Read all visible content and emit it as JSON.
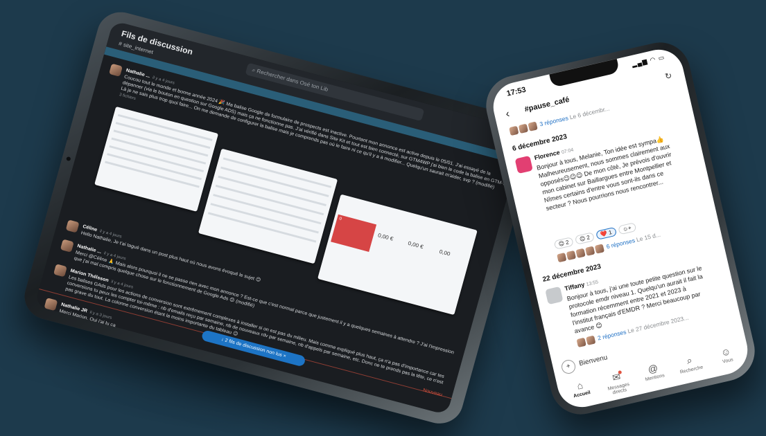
{
  "tablet": {
    "title": "Fils de discussion",
    "channel": "# site_internet",
    "search_placeholder": "Rechercher dans Osé ton Lib",
    "messages": [
      {
        "name": "Nathalie ...",
        "time": "il y a 4 jours",
        "text": "Coucou tout le monde et bonne année 2024 🎉 Ma balise Google de formulaire de prospects est inactive. Pourtant mon annonce est active depuis le 05/01. J'ai essayé de la dépanner (via le bouton en question sur Google ADS) mais ça ne fonctionne pas. J'ai vérifié dans Site Kit et tout est bien connecté, sur GTM4WP j'ai bien le code la balise en GTM-. Là je ne sais plus trop quoi faire... On me demande de configurer la balise mais je comprends pas où le faire ni ce qu'il y a à modifier... Quelqu'un saurait m'aider, svp ? (modifié)",
        "files": "3 fichiers"
      },
      {
        "name": "Céline",
        "time": "il y a 4 jours",
        "text": "Hello Nathalie, Je t'ai tagué dans un post plus haut où nous avons évoqué le sujet 😊"
      },
      {
        "name": "Nathalie ...",
        "time": "il y a 4 jours",
        "text": "Merci @Céline 🙏 Mais alors pourquoi il ne se passe rien avec mon annonce ? Est-ce que c'est normal parce que justement il y a quelques semaines à attendre ? J'ai l'impression que j'ai mal compris quelque chose sur le fonctionnement de Google Ads 😊 (modifié)"
      },
      {
        "name": "Marion Théîsson",
        "time": "il y a 4 jours",
        "text": "Les balises GAds pour les actions de conversion sont extrêmement complexes à installer si on est pas du milieu. Mais comme expliqué plus haut, ça n'a pas d'importance car tes conversions tu peux les compter toi-même : nb d'emails reçu par semaine, nb de nouveaux rdv par semaine, nb d'appels par semaine, etc. Donc ne te prends pas la tête, ce n'est pas grave du tout. La colonne conversion étant la moins importante du tableau 😉"
      },
      {
        "name": "Nathalie JR",
        "time": "il y a 3 jours",
        "text": "Merci Marion, Oui j'ai lu ça"
      }
    ],
    "shot_values": [
      "0",
      "0,00 €",
      "0,00 €",
      "0,00"
    ],
    "unread_pill": "↓ 2 fils de discussion non lus ×",
    "nouveau_label": "Nouveau"
  },
  "phone": {
    "time": "17:53",
    "status": "▂▄▆ ◠ ▭",
    "channel": "#pause_café",
    "top_replies": {
      "link": "3 réponses",
      "meta": "Le 6 décembr..."
    },
    "date1": "6 décembre 2023",
    "msg1": {
      "name": "Florence",
      "time": "07:04",
      "text": "Bonjour à tous, Melanie, Ton idée est sympa👍 Malheureusement, nous sommes clairement aux opposés😉😉😉 De mon côté, Je prévois d'ouvrir mon cabinet sur Baillargues entre Montpellier et Nîmes certains d'entre vous sont-ils dans ce secteur ? Nous pourrions nous rencontrer...",
      "reactions": [
        "😊 2",
        "😊 2",
        "❤️ 1",
        "☺+"
      ],
      "replies_link": "6 réponses",
      "replies_meta": "Le 15 d..."
    },
    "date2": "22 décembre 2023",
    "msg2": {
      "name": "Tiffany",
      "time": "13:55",
      "text": "Bonjour à tous, j'ai une toute petite question sur le protocole emdr niveau 1. Quelqu'un aurait il fait la formation récemment entre 2021 et 2023 à l'institut français d'EMDR ? Merci beaucoup par avance 😊",
      "replies_link": "2 réponses",
      "replies_meta": "Le 27 décembre 2023..."
    },
    "composer_placeholder": "Bienvenu",
    "tabs": [
      {
        "icon": "⌂",
        "label": "Accueil"
      },
      {
        "icon": "✉",
        "label": "Messages directs"
      },
      {
        "icon": "@",
        "label": "Mentions"
      },
      {
        "icon": "⌕",
        "label": "Recherche"
      },
      {
        "icon": "☺",
        "label": "Vous"
      }
    ]
  }
}
